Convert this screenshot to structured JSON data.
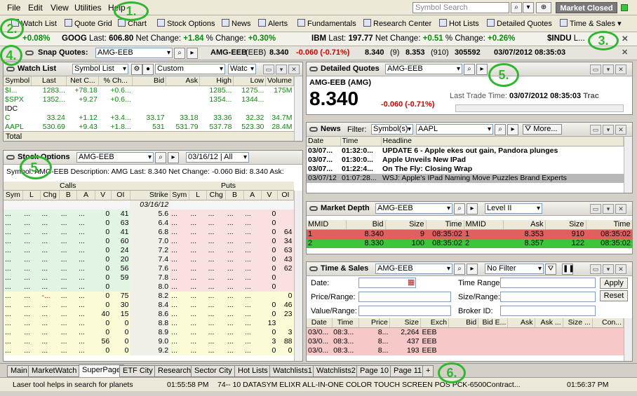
{
  "menu": {
    "items": [
      "File",
      "Edit",
      "View",
      "Utilities",
      "Help"
    ],
    "search_placeholder": "Symbol Search",
    "market_status": "Market Closed"
  },
  "toolbar": {
    "items": [
      "Watch List",
      "Quote Grid",
      "Chart",
      "Stock Options",
      "News",
      "Alerts",
      "Fundamentals",
      "Research Center",
      "Hot Lists",
      "Detailed Quotes",
      "Time & Sales"
    ]
  },
  "ticker": {
    "items": [
      {
        "sym": "",
        "last": "",
        "net": "",
        "pct": "+0.08%"
      },
      {
        "sym": "GOOG",
        "last": "606.80",
        "net": "+1.84",
        "pct": "+0.30%"
      },
      {
        "sym": "IBM",
        "last": "197.77",
        "net": "+0.51",
        "pct": "+0.26%"
      },
      {
        "sym": "$INDU",
        "last": "L..."
      }
    ],
    "last_label": "Last:",
    "net_label": "Net Change:",
    "pct_label": "% Change:"
  },
  "snap": {
    "label": "Snap Quotes:",
    "symbol": "AMG-EEB",
    "title": "AMG-EEB",
    "exch": "(EEB)",
    "last": "8.340",
    "change": "-0.060 (-0.71%)",
    "bid": "8.340",
    "bidsize": "(9)",
    "ask": "8.353",
    "asksize": "(910)",
    "volume": "305592",
    "datetime": "03/07/2012 08:35:03"
  },
  "watchlist": {
    "title": "Watch List",
    "dropdown": "Symbol List",
    "view": "Custom",
    "view2": "Watc",
    "columns": [
      "Symbol",
      "Last",
      "Net C...",
      "% Ch...",
      "Bid",
      "Ask",
      "High",
      "Low",
      "Volume"
    ],
    "rows": [
      [
        "$I...",
        "1283...",
        "+78.18",
        "+0.6...",
        "",
        "",
        "1285...",
        "1275...",
        "175M"
      ],
      [
        "$SPX",
        "1352...",
        "+9.27",
        "+0.6...",
        "",
        "",
        "1354...",
        "1344...",
        ""
      ],
      [
        "IDC",
        "",
        "",
        "",
        "",
        "",
        "",
        "",
        ""
      ],
      [
        "C",
        "33.24",
        "+1.12",
        "+3.4...",
        "33.17",
        "33.18",
        "33.36",
        "32.32",
        "34.7M"
      ],
      [
        "AAPL",
        "530.69",
        "+9.43",
        "+1.8...",
        "531",
        "531.79",
        "537.78",
        "523.30",
        "28.4M"
      ]
    ],
    "total_label": "Total"
  },
  "options": {
    "title": "Stock Options",
    "symbol": "AMG-EEB",
    "expiry": "03/16/12 | All",
    "desc": "Symbol: AMG-EEB  Description: AMG  Last: 8.340  Net Change: -0.060  Bid: 8.340  Ask:",
    "calls_label": "Calls",
    "puts_label": "Puts",
    "strike_label": "Strike",
    "date": "03/16/12",
    "call_cols": [
      "Sym",
      "L",
      "Chg",
      "B",
      "A",
      "V",
      "OI"
    ],
    "put_cols": [
      "Sym",
      "L",
      "Chg",
      "B",
      "A",
      "V",
      "OI"
    ],
    "rows": [
      {
        "c_v": "0",
        "c_oi": "41",
        "strike": "5.6",
        "p_v": "0",
        "p_oi": ""
      },
      {
        "c_v": "0",
        "c_oi": "63",
        "strike": "6.4",
        "p_v": "0",
        "p_oi": ""
      },
      {
        "c_v": "0",
        "c_oi": "41",
        "strike": "6.8",
        "p_v": "0",
        "p_oi": "64"
      },
      {
        "c_v": "0",
        "c_oi": "60",
        "strike": "7.0",
        "p_v": "0",
        "p_oi": "34"
      },
      {
        "c_v": "0",
        "c_oi": "24",
        "strike": "7.2",
        "p_v": "0",
        "p_oi": "63"
      },
      {
        "c_v": "0",
        "c_oi": "20",
        "strike": "7.4",
        "p_v": "0",
        "p_oi": "43"
      },
      {
        "c_v": "0",
        "c_oi": "56",
        "strike": "7.6",
        "p_v": "0",
        "p_oi": "62"
      },
      {
        "c_v": "0",
        "c_oi": "59",
        "strike": "7.8",
        "p_v": "0",
        "p_oi": ""
      },
      {
        "c_v": "0",
        "c_oi": "",
        "strike": "8.0",
        "p_v": "0",
        "p_oi": ""
      },
      {
        "c_v": "0",
        "c_oi": "75",
        "strike": "8.2",
        "p_v": "",
        "p_oi": "0"
      },
      {
        "c_v": "0",
        "c_oi": "30",
        "strike": "8.4",
        "p_v": "0",
        "p_oi": "46"
      },
      {
        "c_v": "40",
        "c_oi": "15",
        "strike": "8.6",
        "p_v": "0",
        "p_oi": "23"
      },
      {
        "c_v": "0",
        "c_oi": "0",
        "strike": "8.8",
        "p_v": "13",
        "p_oi": ""
      },
      {
        "c_v": "0",
        "c_oi": "0",
        "strike": "8.9",
        "p_v": "0",
        "p_oi": "3"
      },
      {
        "c_v": "56",
        "c_oi": "0",
        "strike": "9.0",
        "p_v": "3",
        "p_oi": "88"
      },
      {
        "c_v": "0",
        "c_oi": "0",
        "strike": "9.2",
        "p_v": "0",
        "p_oi": "0"
      }
    ]
  },
  "detailed": {
    "title": "Detailed Quotes",
    "symbol": "AMG-EEB",
    "name": "AMG-EEB (AMG)",
    "last": "8.340",
    "change": "-0.060 (-0.71%)",
    "ltt_label": "Last Trade Time:",
    "ltt": "03/07/2012 08:35:03",
    "trade_label": "Trac"
  },
  "news": {
    "title": "News",
    "filter_label": "Filter:",
    "filter": "Symbol(s)",
    "symbol": "AAPL",
    "more": "More...",
    "columns": [
      "Date",
      "Time",
      "Headline"
    ],
    "rows": [
      [
        "03/07...",
        "01:32:0...",
        "UPDATE 6 - Apple ekes out gain, Pandora plunges"
      ],
      [
        "03/07...",
        "01:30:0...",
        "Apple Unveils New IPad"
      ],
      [
        "03/07...",
        "01:22:4...",
        "On The Fly: Closing Wrap"
      ],
      [
        "03/07/12",
        "01:07:28...",
        "WSJ: Apple's IPad Naming Move Puzzles Brand Experts"
      ]
    ]
  },
  "depth": {
    "title": "Market Depth",
    "symbol": "AMG-EEB",
    "level": "Level II",
    "columns": [
      "MMID",
      "Bid",
      "Size",
      "Time",
      "MMID",
      "Ask",
      "Size",
      "Time"
    ],
    "rows": [
      [
        "1",
        "8.340",
        "9",
        "08:35:02",
        "1",
        "8.353",
        "910",
        "08:35:02"
      ],
      [
        "2",
        "8.330",
        "100",
        "08:35:02",
        "2",
        "8.357",
        "122",
        "08:35:02"
      ]
    ]
  },
  "ts": {
    "title": "Time & Sales",
    "symbol": "AMG-EEB",
    "filter": "No Filter",
    "date_label": "Date:",
    "price_label": "Price/Range:",
    "value_label": "Value/Range:",
    "timerange_label": "Time Range:",
    "size_label": "Size/Range:",
    "broker_label": "Broker ID:",
    "apply": "Apply",
    "reset": "Reset",
    "columns": [
      "Date",
      "Time",
      "Price",
      "Size",
      "Exch",
      "Bid",
      "Bid E...",
      "Ask",
      "Ask ...",
      "Size ...",
      "Con..."
    ],
    "rows": [
      [
        "03/0...",
        "08:3...",
        "8...",
        "2,264",
        "EEB"
      ],
      [
        "03/0...",
        "08:3...",
        "8...",
        "437",
        "EEB"
      ],
      [
        "03/0...",
        "08:3...",
        "8...",
        "193",
        "EEB"
      ]
    ]
  },
  "tabs": [
    "Main",
    "MarketWatch",
    "SuperPage",
    "ETF City",
    "Research",
    "Sector City",
    "Hot Lists",
    "Watchlists1",
    "Watchlists2",
    "Page 10",
    "Page 11",
    "+"
  ],
  "status": {
    "msg1": "Laser tool helps in search for planets",
    "time1": "01:55:58 PM",
    "msg2": "74-- 10 DATASYM ELIXR ALL-IN-ONE COLOR TOUCH SCREEN POS PCK-6500Contract...",
    "time2": "01:56:37 PM"
  },
  "annotations": [
    "1.",
    "2.",
    "3.",
    "4.",
    "5.",
    "5.",
    "6."
  ],
  "colors": {
    "positive": "#0a8a0a",
    "negative": "#d00000",
    "annotation": "#2fb82f"
  }
}
